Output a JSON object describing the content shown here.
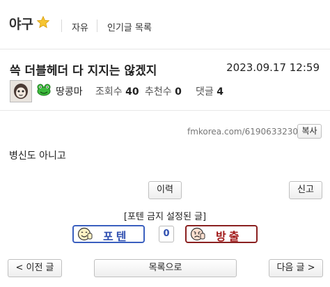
{
  "header": {
    "board_title": "야구",
    "board_icon": "star-icon",
    "nav": [
      "자유",
      "인기글 목록"
    ]
  },
  "post": {
    "title": "쓱 더블헤더 다 지지는 않겠지",
    "date": "2023.09.17 12:59",
    "author": "땅콩마",
    "views_label": "조회수",
    "views": "40",
    "likes_label": "추천수",
    "likes": "0",
    "comments_label": "댓글",
    "comments": "4",
    "url": "fmkorea.com/6190633230",
    "copy_label": "복사",
    "body": "병신도 아니고"
  },
  "actions": {
    "history_label": "이력",
    "report_label": "신고"
  },
  "vote": {
    "note": "[포텐 금지 설정된 글]",
    "up_label": "포텐",
    "count": "0",
    "down_label": "방출",
    "up_color": "#2f4fb0",
    "down_color": "#a11818"
  },
  "footer": {
    "prev_label": "< 이전 글",
    "list_label": "목록으로",
    "next_label": "다음 글 >"
  }
}
